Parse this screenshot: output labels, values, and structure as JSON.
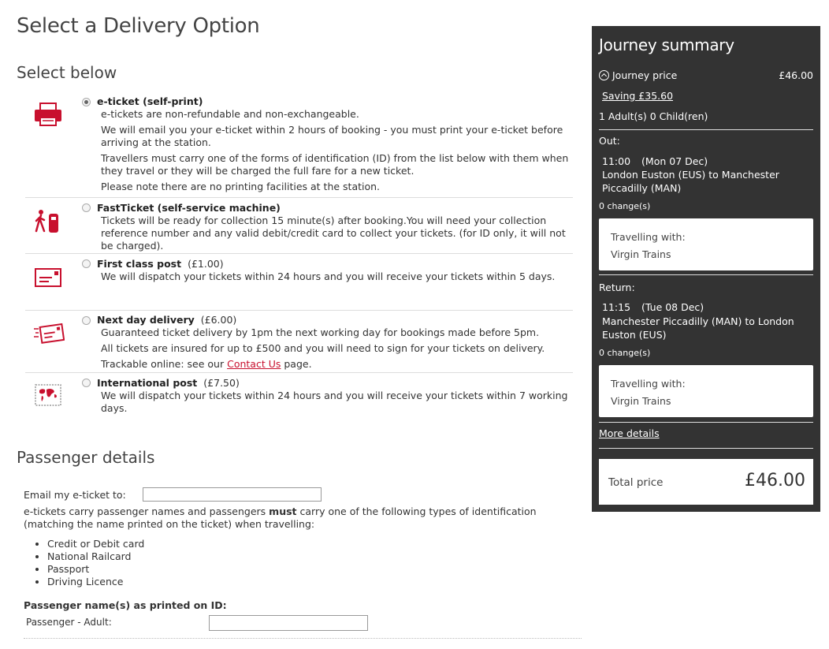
{
  "page_title": "Select a Delivery Option",
  "select_below": "Select below",
  "options": [
    {
      "title": "e-ticket (self-print)",
      "price": "",
      "checked": true,
      "icon": "printer-icon",
      "lines": [
        "e-tickets are non-refundable and non-exchangeable.",
        "We will email you your e-ticket within 2 hours of booking - you must print your e-ticket before arriving at the station.",
        "Travellers must carry one of the forms of identification (ID) from the list below with them when they travel or they will be charged the full fare for a new ticket.",
        "Please note there are no printing facilities at the station."
      ]
    },
    {
      "title": "FastTicket (self-service machine)",
      "price": "",
      "checked": false,
      "icon": "ticket-machine-icon",
      "lines": [
        "Tickets will be ready for collection 15 minute(s) after booking.You will need your collection reference number and any valid debit/credit card to collect your tickets. (for ID only, it will not be charged)."
      ]
    },
    {
      "title": "First class post",
      "price": "(£1.00)",
      "checked": false,
      "icon": "envelope-icon",
      "lines": [
        "We will dispatch your tickets within 24 hours and you will receive your tickets within 5 days."
      ]
    },
    {
      "title": "Next day delivery",
      "price": "(£6.00)",
      "checked": false,
      "icon": "fast-envelope-icon",
      "lines": [
        "Guaranteed ticket delivery by 1pm the next working day for bookings made before 5pm.",
        "All tickets are insured for up to £500 and you will need to sign for your tickets on delivery."
      ],
      "trackable_prefix": "Trackable online: see our",
      "trackable_link": "Contact Us",
      "trackable_suffix": "page."
    },
    {
      "title": "International post",
      "price": "(£7.50)",
      "checked": false,
      "icon": "world-map-stamp-icon",
      "lines": [
        "We will dispatch your tickets within 24 hours and you will receive your tickets within 7 working days."
      ]
    }
  ],
  "passenger": {
    "heading": "Passenger details",
    "email_label": "Email my e-ticket to:",
    "email_value": "",
    "ids_intro_pre": "e-tickets carry passenger names and passengers",
    "ids_intro_bold": "must",
    "ids_intro_post": "carry one of the following types of identification (matching the name printed on the ticket) when travelling:",
    "id_types": [
      "Credit or Debit card",
      "National Railcard",
      "Passport",
      "Driving Licence"
    ],
    "names_heading": "Passenger name(s) as printed on ID:",
    "adult_label": "Passenger - Adult:",
    "adult_value": ""
  },
  "summary": {
    "title": "Journey summary",
    "journey_price_label": "Journey price",
    "journey_price": "£46.00",
    "saving": "Saving £35.60",
    "passengers": "1 Adult(s) 0 Child(ren)",
    "out": {
      "label": "Out:",
      "time": "11:00",
      "date": "(Mon 07 Dec)",
      "route": "London Euston (EUS) to Manchester Piccadilly (MAN)",
      "changes": "0 change(s)",
      "travelling_with_label": "Travelling with:",
      "operator": "Virgin Trains"
    },
    "return": {
      "label": "Return:",
      "time": "11:15",
      "date": "(Tue 08 Dec)",
      "route": "Manchester Piccadilly (MAN) to London Euston (EUS)",
      "changes": "0 change(s)",
      "travelling_with_label": "Travelling with:",
      "operator": "Virgin Trains"
    },
    "more_details": "More details",
    "total_label": "Total price",
    "total_value": "£46.00"
  },
  "colors": {
    "brand_red": "#c8102e",
    "summary_bg": "#333333"
  }
}
